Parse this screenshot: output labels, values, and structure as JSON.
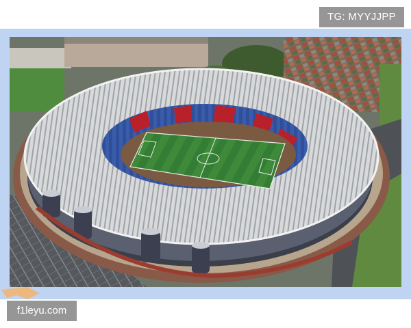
{
  "watermarks": {
    "telegram": "TG: MYYJJPP",
    "site": "f1leyu.com"
  },
  "photo": {
    "subject": "stadium",
    "colors": {
      "frame": "#bfd3f3",
      "pitch_light": "#3f8a3a",
      "pitch_dark": "#2f7430",
      "roof": "#d9dadb",
      "seats_red": "#b8202a",
      "seats_blue": "#2f4f9a",
      "watermark_bg": "#787878"
    }
  }
}
